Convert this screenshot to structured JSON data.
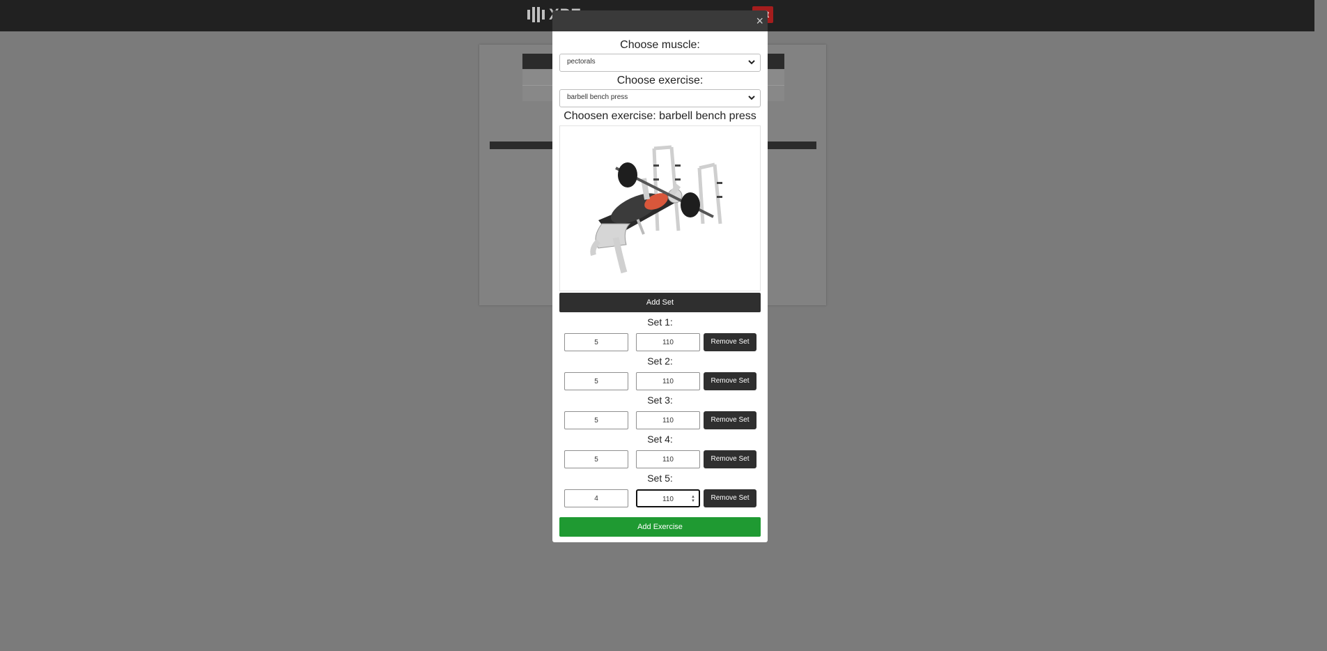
{
  "header": {
    "logo_text": "XPE",
    "logout_label": "out"
  },
  "modal": {
    "close_glyph": "×",
    "muscle": {
      "title": "Choose muscle:",
      "selected": "pectorals"
    },
    "exercise": {
      "title": "Choose exercise:",
      "selected": "barbell bench press"
    },
    "chosen_label": "Choosen exercise: barbell bench press",
    "add_set_label": "Add Set",
    "remove_set_label": "Remove Set",
    "sets": [
      {
        "label": "Set 1:",
        "reps": "5",
        "weight": "110"
      },
      {
        "label": "Set 2:",
        "reps": "5",
        "weight": "110"
      },
      {
        "label": "Set 3:",
        "reps": "5",
        "weight": "110"
      },
      {
        "label": "Set 4:",
        "reps": "5",
        "weight": "110"
      },
      {
        "label": "Set 5:",
        "reps": "4",
        "weight": "110"
      }
    ],
    "add_exercise_label": "Add Exercise"
  },
  "colors": {
    "primary_dark": "#2f2f2f",
    "accent_green": "#1f9a32",
    "logout_red": "#a51d1d"
  },
  "icons": {
    "select_chevron": "chevron-down-icon",
    "close": "close-icon"
  }
}
